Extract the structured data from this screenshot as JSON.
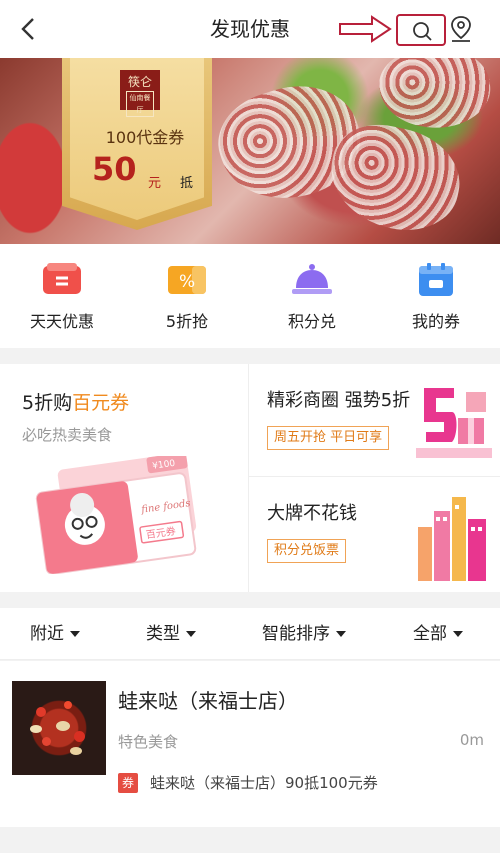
{
  "header": {
    "title": "发现优惠",
    "back_icon": "back-chevron-icon",
    "search_icon": "search-icon",
    "location_icon": "location-pin-icon"
  },
  "banner": {
    "brand_line1": "筷仑",
    "brand_line2": "仙南餐厅",
    "voucher_title": "100代金券",
    "voucher_amount": "50",
    "voucher_unit": "元",
    "voucher_suffix": "抵",
    "slide_count": 2,
    "active_slide": 1
  },
  "quick_entries": [
    {
      "label": "天天优惠",
      "icon": "daily-deals-icon",
      "color": "#f0504a"
    },
    {
      "label": "5折抢",
      "icon": "percent-coupon-icon",
      "color": "#f6a623"
    },
    {
      "label": "积分兑",
      "icon": "cloche-icon",
      "color": "#8c6cf0"
    },
    {
      "label": "我的券",
      "icon": "wallet-icon",
      "color": "#3d8ef0"
    }
  ],
  "promos": {
    "left": {
      "title_prefix": "5折购",
      "title_highlight": "百元券",
      "subtitle": "必吃热卖美食",
      "ticket_price": "¥100",
      "ticket_script": "fine foods",
      "ticket_label": "百元券"
    },
    "right_top": {
      "title": "精彩商圈 强势5折",
      "tag": "周五开抢 平日可享"
    },
    "right_bottom": {
      "title": "大牌不花钱",
      "tag": "积分兑饭票"
    }
  },
  "filters": [
    {
      "label": "附近"
    },
    {
      "label": "类型"
    },
    {
      "label": "智能排序"
    },
    {
      "label": "全部"
    }
  ],
  "stores": [
    {
      "name": "蛙来哒（来福士店）",
      "category": "特色美食",
      "distance": "0m",
      "coupon_badge": "券",
      "coupon_text": "蛙来哒（来福士店）90抵100元券"
    }
  ],
  "colors": {
    "accent": "#e54d42",
    "highlight": "#f08a1e",
    "annotation": "#b8203a"
  }
}
